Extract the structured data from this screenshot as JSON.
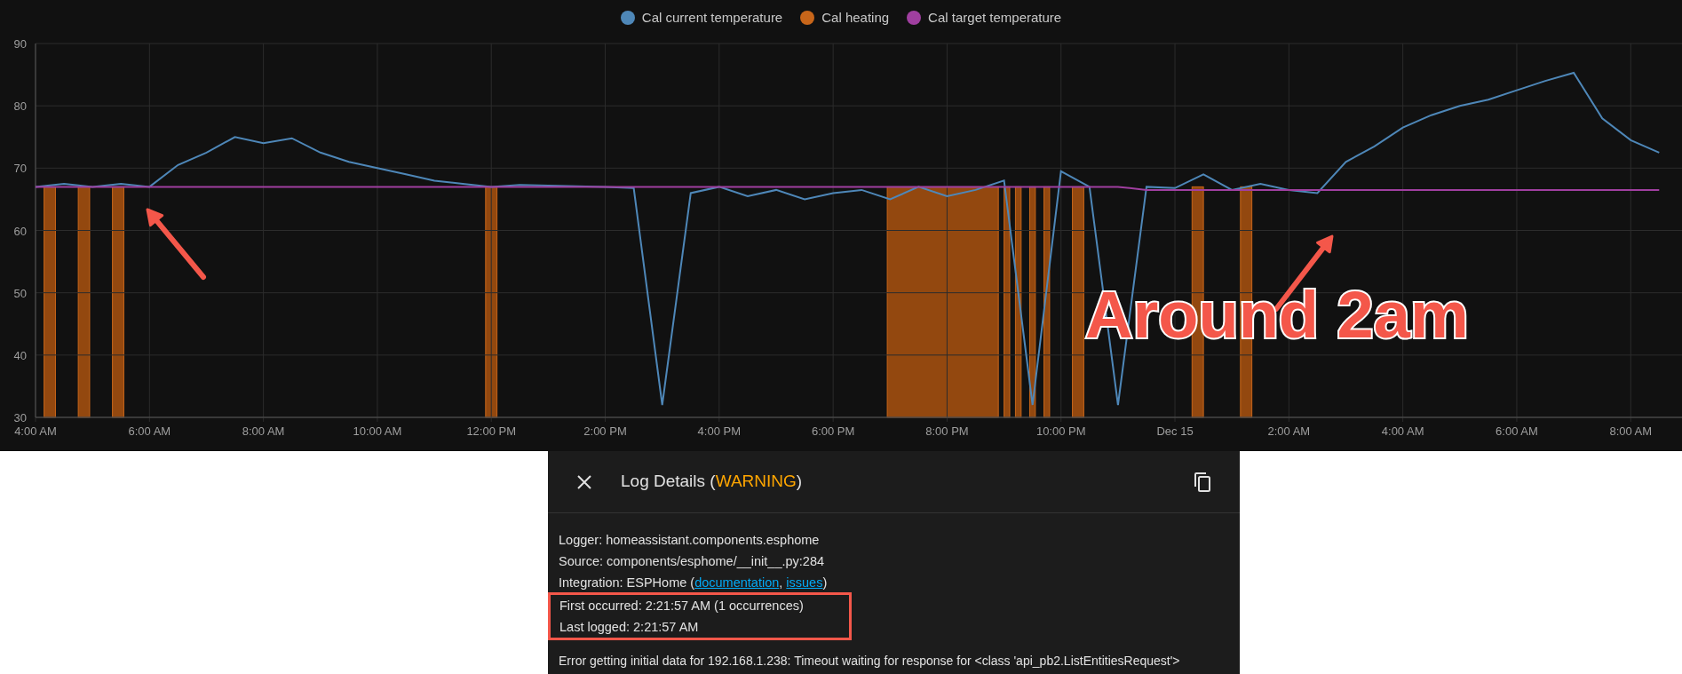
{
  "chart": {
    "heating": {
      "name": "Cal heating",
      "color": "#c8661a"
    },
    "chart_data": {
      "type": "line",
      "grid": true,
      "ylim": [
        30,
        90
      ],
      "yticks": [
        30,
        40,
        50,
        60,
        70,
        80,
        90
      ],
      "categories": [
        "4:00 AM",
        null,
        null,
        null,
        "6:00 AM",
        null,
        null,
        null,
        "8:00 AM",
        null,
        null,
        null,
        "10:00 AM",
        null,
        null,
        null,
        "12:00 PM",
        null,
        null,
        null,
        "2:00 PM",
        null,
        null,
        null,
        "4:00 PM",
        null,
        null,
        null,
        "6:00 PM",
        null,
        null,
        null,
        "8:00 PM",
        null,
        null,
        null,
        "10:00 PM",
        null,
        null,
        null,
        "Dec 15",
        null,
        null,
        null,
        "2:00 AM",
        null,
        null,
        null,
        "4:00 AM",
        null,
        null,
        null,
        "6:00 AM",
        null,
        null,
        null,
        "8:00 AM",
        null
      ],
      "series": [
        {
          "name": "Cal current temperature",
          "color": "#4e87b8",
          "values": [
            67,
            67.5,
            67,
            67.5,
            67,
            70.5,
            72.5,
            75,
            74,
            74.8,
            72.5,
            71,
            70,
            69,
            68,
            67.5,
            67,
            67.3,
            67.2,
            67.1,
            67,
            66.8,
            32,
            66,
            67,
            65.5,
            66.5,
            65,
            66,
            66.5,
            65,
            67,
            65.5,
            66.5,
            68,
            32,
            69.5,
            67,
            32,
            67,
            66.8,
            69,
            66.5,
            67.5,
            66.5,
            66,
            71,
            73.5,
            76.5,
            78.5,
            80,
            81,
            82.5,
            84,
            85.3,
            78,
            74.5,
            72.5
          ]
        },
        {
          "name": "Cal target temperature",
          "color": "#a03fa0",
          "values": [
            67,
            67,
            67,
            67,
            67,
            67,
            67,
            67,
            67,
            67,
            67,
            67,
            67,
            67,
            67,
            67,
            67,
            67,
            67,
            67,
            67,
            67,
            67,
            67,
            67,
            67,
            67,
            67,
            67,
            67,
            67,
            67,
            67,
            67,
            67,
            67,
            67,
            67,
            67,
            66.5,
            66.5,
            66.5,
            66.5,
            66.5,
            66.5,
            66.5,
            66.5,
            66.5,
            66.5,
            66.5,
            66.5,
            66.5,
            66.5,
            66.5,
            66.5,
            66.5,
            66.5,
            66.5
          ]
        }
      ]
    }
  },
  "annotation": {
    "text": "Around 2am"
  },
  "dialog": {
    "title_prefix": "Log Details (",
    "level": "WARNING",
    "title_suffix": ")",
    "lines": [
      {
        "parts": [
          {
            "kind": "text",
            "text": "Logger: homeassistant.components.esphome"
          }
        ]
      },
      {
        "parts": [
          {
            "kind": "text",
            "text": "Source: components/esphome/__init__.py:284"
          }
        ]
      },
      {
        "parts": [
          {
            "kind": "text",
            "text": "Integration: ESPHome ("
          },
          {
            "kind": "link",
            "text": "documentation"
          },
          {
            "kind": "text",
            "text": ", "
          },
          {
            "kind": "link",
            "text": "issues"
          },
          {
            "kind": "text",
            "text": ")"
          }
        ]
      }
    ],
    "highlighted_lines": [
      "First occurred: 2:21:57 AM (1 occurrences)",
      "Last logged: 2:21:57 AM"
    ],
    "message": "Error getting initial data for 192.168.1.238: Timeout waiting for response for <class 'api_pb2.ListEntitiesRequest'>"
  }
}
